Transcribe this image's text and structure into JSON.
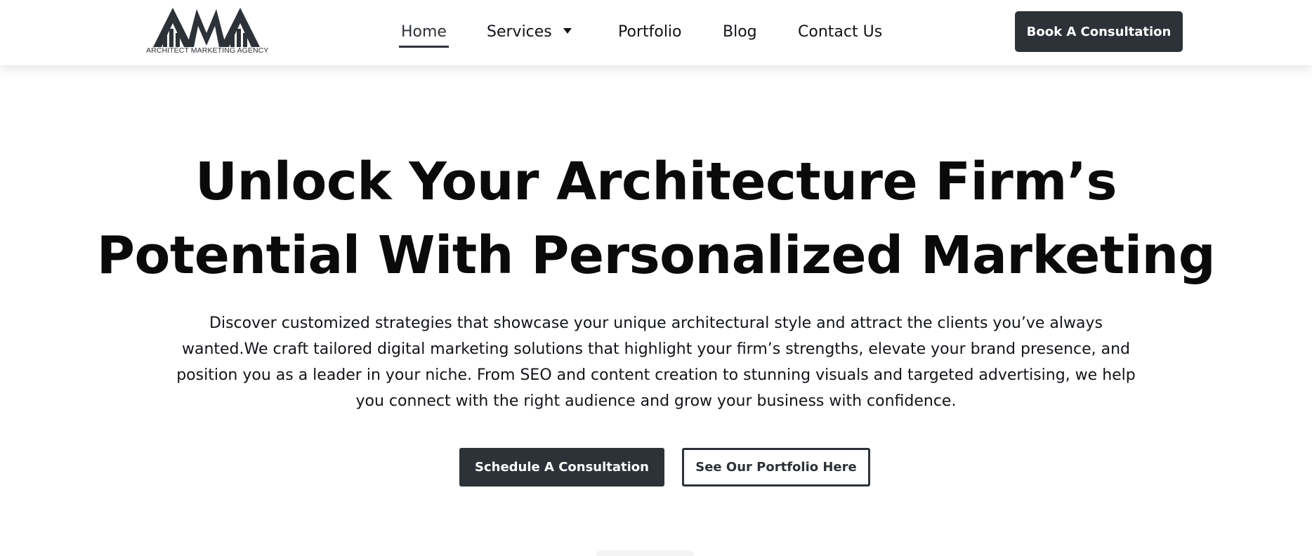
{
  "header": {
    "logo": {
      "mark_text": "AMA",
      "tagline": "ARCHITECT MARKETING AGENCY"
    },
    "nav": [
      {
        "label": "Home",
        "active": true
      },
      {
        "label": "Services",
        "has_dropdown": true
      },
      {
        "label": "Portfolio"
      },
      {
        "label": "Blog"
      },
      {
        "label": "Contact Us"
      }
    ],
    "cta_label": "Book A Consultation"
  },
  "hero": {
    "title_line1": "Unlock Your Architecture Firm’s",
    "title_line2": "Potential With Personalized Marketing",
    "description": "Discover customized strategies that showcase your unique architectural style and attract the clients you’ve always wanted.We craft tailored digital marketing solutions that highlight your firm’s strengths, elevate your brand presence, and position you as a leader in your niche. From SEO and content creation to stunning visuals and targeted advertising, we help you connect with the right audience and grow your business with confidence.",
    "primary_button": "Schedule A Consultation",
    "secondary_button": "See Our Portfolio Here"
  },
  "colors": {
    "dark": "#2d3238",
    "background": "#ffffff",
    "text": "#0a0a0a"
  }
}
